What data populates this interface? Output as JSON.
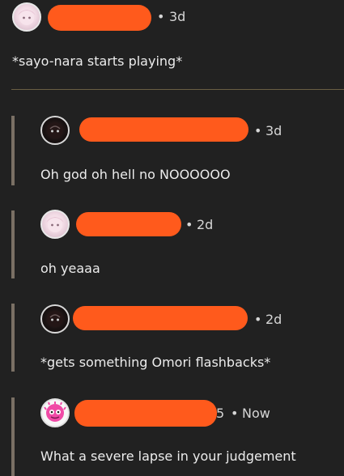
{
  "post": {
    "timestamp": "3d",
    "text": "*sayo-nara starts playing*",
    "avatar_icon": "anime-girl-avatar-icon",
    "redaction_color": "#ff5a1c"
  },
  "replies": [
    {
      "timestamp": "3d",
      "text": "Oh god oh hell no NOOOOOO",
      "avatar_icon": "dark-creature-avatar-icon"
    },
    {
      "timestamp": "2d",
      "text": "oh yeaaa",
      "avatar_icon": "anime-girl-avatar-icon"
    },
    {
      "timestamp": "2d",
      "text": "*gets something Omori flashbacks*",
      "avatar_icon": "dark-creature-avatar-icon"
    },
    {
      "timestamp": "Now",
      "text": "What a severe lapse in your judgement",
      "avatar_icon": "pink-creature-avatar-icon",
      "username_tail": "5"
    }
  ],
  "separator": "•"
}
